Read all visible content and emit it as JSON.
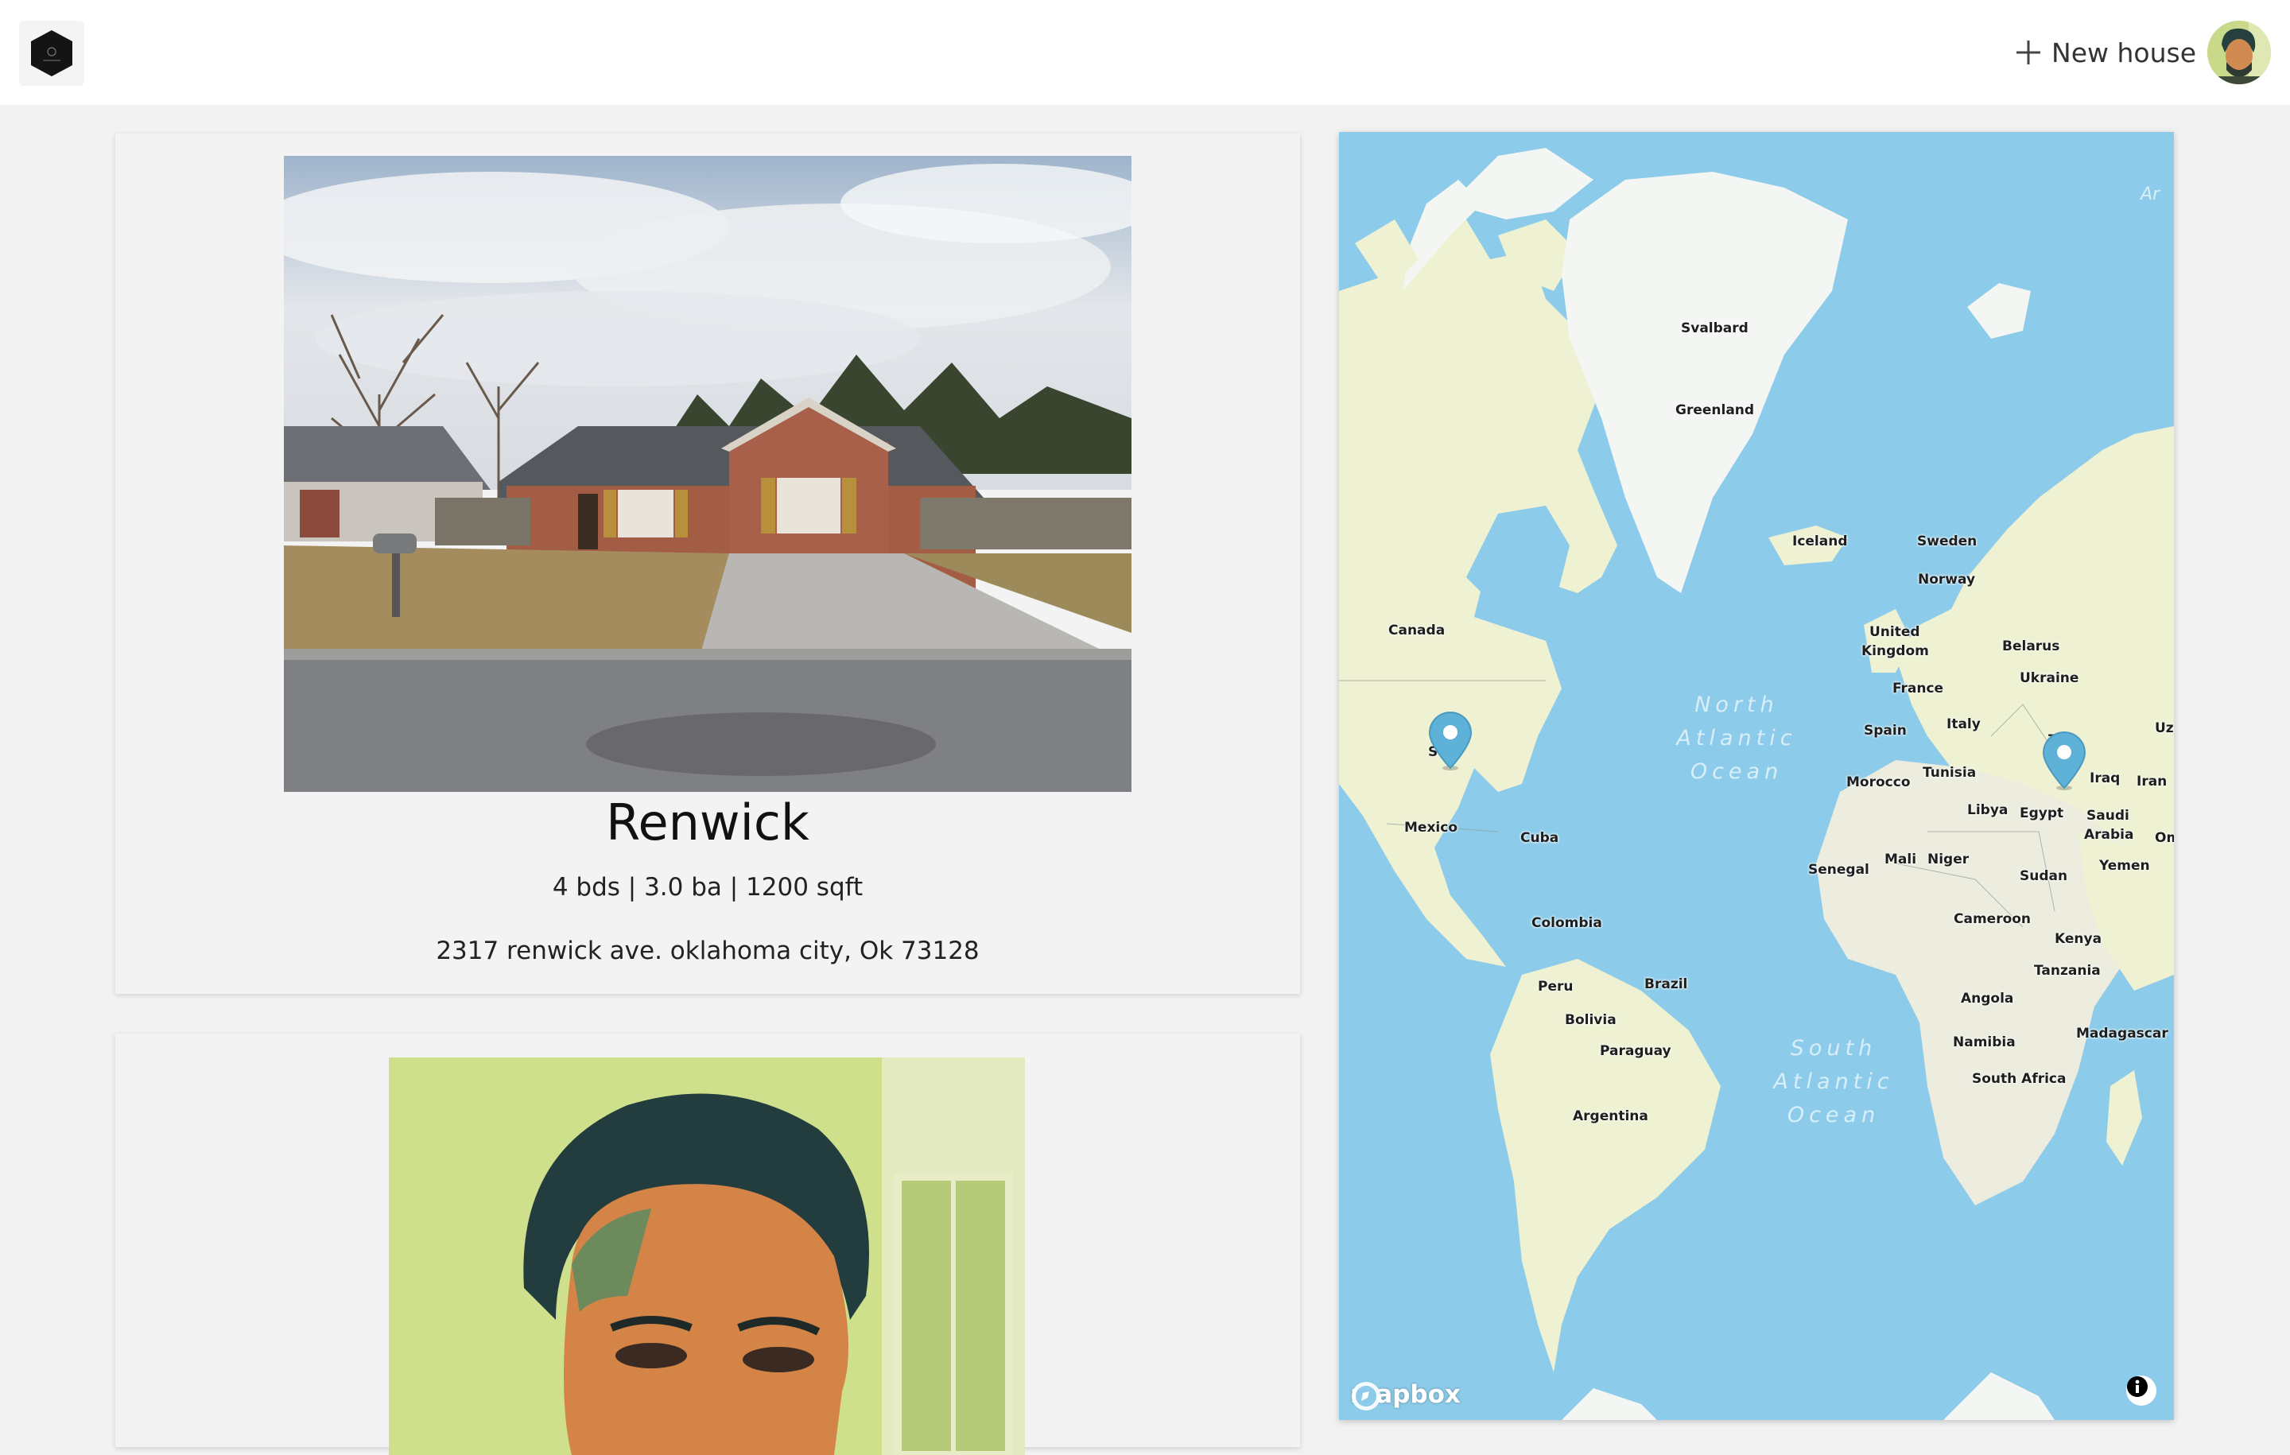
{
  "header": {
    "new_house_label": "New house"
  },
  "houses": [
    {
      "name": "Renwick",
      "stats": "4 bds | 3.0 ba | 1200 sqft",
      "address": "2317 renwick ave. oklahoma city, Ok 73128"
    },
    {
      "name": "",
      "stats": "",
      "address": ""
    }
  ],
  "map": {
    "attribution": "mapbox",
    "labels": {
      "svalbard": "Svalbard",
      "greenland": "Greenland",
      "iceland": "Iceland",
      "sweden": "Sweden",
      "norway": "Norway",
      "canada": "Canada",
      "united_kingdom_1": "United",
      "united_kingdom_2": "Kingdom",
      "belarus": "Belarus",
      "ukraine": "Ukraine",
      "france": "France",
      "spain": "Spain",
      "italy": "Italy",
      "uz": "Uz",
      "states": "S   s",
      "tunisia": "Tunisia",
      "morocco": "Morocco",
      "iraq": "Iraq",
      "iran": "Iran",
      "libya": "Libya",
      "egypt": "Egypt",
      "saudi_1": "Saudi",
      "saudi_2": "Arabia",
      "oman": "Oma",
      "mexico": "Mexico",
      "cuba": "Cuba",
      "senegal": "Senegal",
      "mali": "Mali",
      "niger": "Niger",
      "yemen": "Yemen",
      "sudan": "Sudan",
      "colombia": "Colombia",
      "cameroon": "Cameroon",
      "kenya": "Kenya",
      "tanzania": "Tanzania",
      "peru": "Peru",
      "brazil": "Brazil",
      "angola": "Angola",
      "bolivia": "Bolivia",
      "namibia": "Namibia",
      "madagascar": "Madagascar",
      "paraguay": "Paraguay",
      "south_africa": "South Africa",
      "argentina": "Argentina",
      "ar": "Ar",
      "turkey": "T   y"
    },
    "oceans": {
      "north_atlantic": [
        "North",
        "Atlantic",
        "Ocean"
      ],
      "south_atlantic": [
        "South",
        "Atlantic",
        "Ocean"
      ]
    },
    "colors": {
      "water": "#8ccbe9",
      "land": "#eef1d2",
      "land_africa": "#ececdf",
      "ice": "#f4f6f4",
      "pin": "#5eb2d8"
    }
  }
}
